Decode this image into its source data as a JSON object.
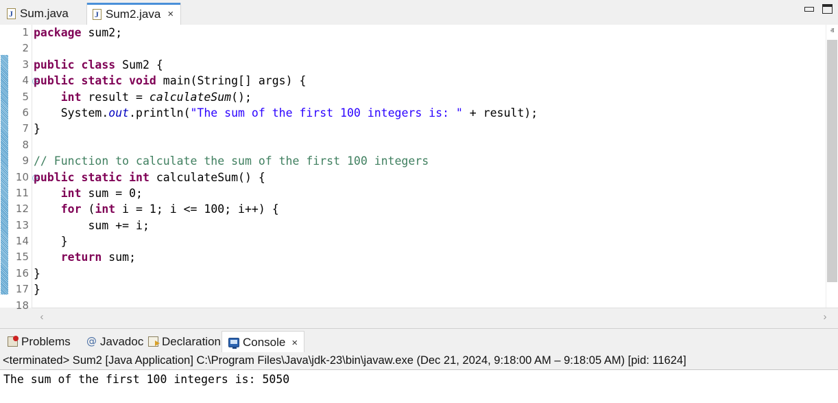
{
  "window": {
    "minimize_label": "minimize",
    "maximize_label": "maximize"
  },
  "editor_tabs": [
    {
      "label": "Sum.java",
      "icon": "java-file-icon",
      "active": false,
      "closable": false
    },
    {
      "label": "Sum2.java",
      "icon": "java-file-icon",
      "active": true,
      "closable": true,
      "close_glyph": "×"
    }
  ],
  "editor": {
    "line_numbers": [
      "1",
      "2",
      "3",
      "4",
      "5",
      "6",
      "7",
      "8",
      "9",
      "10",
      "11",
      "12",
      "13",
      "14",
      "15",
      "16",
      "17",
      "18"
    ],
    "fold_lines": [
      4,
      10
    ],
    "code_lines": [
      [
        {
          "t": "package",
          "c": "kw"
        },
        {
          "t": " sum2;",
          "c": "pln"
        }
      ],
      [],
      [
        {
          "t": "public",
          "c": "kw"
        },
        {
          "t": " ",
          "c": "pln"
        },
        {
          "t": "class",
          "c": "kw"
        },
        {
          "t": " Sum2 {",
          "c": "pln"
        }
      ],
      [
        {
          "t": "public",
          "c": "kw"
        },
        {
          "t": " ",
          "c": "pln"
        },
        {
          "t": "static",
          "c": "kw"
        },
        {
          "t": " ",
          "c": "pln"
        },
        {
          "t": "void",
          "c": "kw"
        },
        {
          "t": " main(String[] args) {",
          "c": "pln"
        }
      ],
      [
        {
          "t": "    ",
          "c": "pln"
        },
        {
          "t": "int",
          "c": "kw"
        },
        {
          "t": " result = ",
          "c": "pln"
        },
        {
          "t": "calculateSum",
          "c": "smeth"
        },
        {
          "t": "();",
          "c": "pln"
        }
      ],
      [
        {
          "t": "    System.",
          "c": "pln"
        },
        {
          "t": "out",
          "c": "sfld"
        },
        {
          "t": ".println(",
          "c": "pln"
        },
        {
          "t": "\"The sum of the first 100 integers is: \"",
          "c": "str"
        },
        {
          "t": " + result);",
          "c": "pln"
        }
      ],
      [
        {
          "t": "}",
          "c": "pln"
        }
      ],
      [],
      [
        {
          "t": "// Function to calculate the sum of the first 100 integers",
          "c": "cmt"
        }
      ],
      [
        {
          "t": "public",
          "c": "kw"
        },
        {
          "t": " ",
          "c": "pln"
        },
        {
          "t": "static",
          "c": "kw"
        },
        {
          "t": " ",
          "c": "pln"
        },
        {
          "t": "int",
          "c": "kw"
        },
        {
          "t": " calculateSum() {",
          "c": "pln"
        }
      ],
      [
        {
          "t": "    ",
          "c": "pln"
        },
        {
          "t": "int",
          "c": "kw"
        },
        {
          "t": " sum = 0;",
          "c": "pln"
        }
      ],
      [
        {
          "t": "    ",
          "c": "pln"
        },
        {
          "t": "for",
          "c": "kw"
        },
        {
          "t": " (",
          "c": "pln"
        },
        {
          "t": "int",
          "c": "kw"
        },
        {
          "t": " i = 1; i <= 100; i++) {",
          "c": "pln"
        }
      ],
      [
        {
          "t": "        sum += i;",
          "c": "pln"
        }
      ],
      [
        {
          "t": "    }",
          "c": "pln"
        }
      ],
      [
        {
          "t": "    ",
          "c": "pln"
        },
        {
          "t": "return",
          "c": "kw"
        },
        {
          "t": " sum;",
          "c": "pln"
        }
      ],
      [
        {
          "t": "}",
          "c": "pln"
        }
      ],
      [
        {
          "t": "}",
          "c": "pln"
        }
      ],
      []
    ],
    "scroll_up_glyph": "ⱏ",
    "scroll_down_glyph": "ⱟ",
    "hscroll_left_glyph": "‹",
    "hscroll_right_glyph": "›"
  },
  "view_tabs": [
    {
      "label": "Problems",
      "icon": "problems-icon",
      "active": false,
      "closable": false
    },
    {
      "label": "Javadoc",
      "icon": "javadoc-icon",
      "active": false,
      "closable": false,
      "glyph": "@"
    },
    {
      "label": "Declaration",
      "icon": "declaration-icon",
      "active": false,
      "closable": false
    },
    {
      "label": "Console",
      "icon": "console-icon",
      "active": true,
      "closable": true,
      "close_glyph": "×"
    }
  ],
  "console": {
    "header": "<terminated> Sum2 [Java Application] C:\\Program Files\\Java\\jdk-23\\bin\\javaw.exe  (Dec 21, 2024, 9:18:00 AM – 9:18:05 AM) [pid: 11624]",
    "output": "The sum of the first 100 integers is: 5050"
  },
  "colors": {
    "keyword": "#7F0055",
    "string": "#2A00FF",
    "comment": "#3F7F5F",
    "static_field": "#0000C0",
    "tab_accent": "#4A90D9",
    "change_bar": "#3F8FC4"
  }
}
